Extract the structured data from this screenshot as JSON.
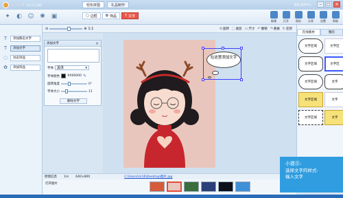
{
  "app": {
    "name": "可牛影像",
    "version": "V1.2.3.308"
  },
  "top_tabs": [
    {
      "label": "轻松拼图",
      "on": true
    },
    {
      "label": "礼品制作",
      "on": false
    }
  ],
  "window": {
    "user": "登录 会员中心",
    "min": "–",
    "max": "□",
    "close": "×"
  },
  "modes": [
    {
      "label": "边框",
      "on": false
    },
    {
      "label": "饰品",
      "on": false
    },
    {
      "label": "文字",
      "on": true
    }
  ],
  "right_tools": [
    "新建",
    "打开",
    "保存",
    "分享",
    "设置",
    "帮助"
  ],
  "zoom": {
    "label": "1:1"
  },
  "edit_ops": [
    {
      "icon": "⟲",
      "label": "旋转"
    },
    {
      "icon": "⬚",
      "label": "裁剪"
    },
    {
      "icon": "▭",
      "label": "尺寸"
    },
    {
      "icon": "↶",
      "label": "撤销"
    },
    {
      "icon": "↷",
      "label": "重做"
    },
    {
      "icon": "↻",
      "label": "还原"
    }
  ],
  "sidebar": [
    {
      "icon": "T",
      "label": "添加静态文字",
      "on": false
    },
    {
      "icon": "T",
      "label": "添加文字",
      "on": true
    },
    {
      "icon": "◌",
      "label": "动态饰品",
      "on": false
    },
    {
      "icon": "✿",
      "label": "添加饰品",
      "on": false
    }
  ],
  "text_panel": {
    "title": "添加文字",
    "close": "×",
    "text_value": "",
    "font_label": "字体",
    "font_value": "黑体",
    "color_label": "字体颜色",
    "color_hex": "#000000",
    "angle_label": "旋转角度",
    "angle_value": "0°",
    "size_label": "字体大小",
    "size_value": "11",
    "delete_button": "删除文字"
  },
  "canvas": {
    "bubble_text": "在这里添加文字"
  },
  "right_panel": {
    "tabs": [
      {
        "label": "在线素材",
        "on": true
      },
      {
        "label": "我的",
        "on": false
      }
    ],
    "thumbs": [
      {
        "label": "文字区域",
        "style": "cloud"
      },
      {
        "label": "文字区",
        "style": "plain"
      },
      {
        "label": "文字区域",
        "style": "round"
      },
      {
        "label": "文字区",
        "style": "sel"
      },
      {
        "label": "文字区域",
        "style": "cloud"
      },
      {
        "label": "文字",
        "style": "round"
      },
      {
        "label": "文字区域",
        "style": "yellow"
      },
      {
        "label": "文字",
        "style": "plain"
      },
      {
        "label": "文字区域",
        "style": "spiky"
      },
      {
        "label": "文字",
        "style": "yellow"
      }
    ]
  },
  "statusbar": {
    "left": "原图信息",
    "size": "1m",
    "dims": "640×800",
    "path": "C:\\Users\\Ur16\\Desktop\\图片.jpg"
  },
  "filmstrip": {
    "label": "打开图片"
  },
  "hint": {
    "title": "小提示:",
    "line1": "选择文字的样式-",
    "line2": "输入文字"
  },
  "colors": {
    "accent": "#e8584b",
    "hint_bg": "#2f9de0",
    "selection": "#3d3dff"
  }
}
